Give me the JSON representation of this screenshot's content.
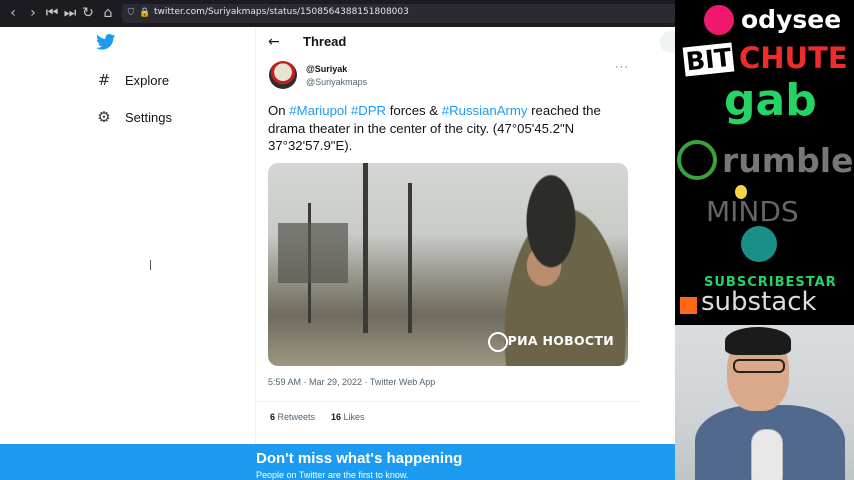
{
  "browser": {
    "url": "twitter.com/Suriyakmaps/status/1508564388151808003",
    "icons": [
      "back-icon",
      "forward-icon",
      "first-icon",
      "last-icon",
      "reload-icon",
      "home-icon",
      "shield-icon",
      "lock-icon"
    ]
  },
  "leftnav": {
    "explore": "Explore",
    "settings": "Settings"
  },
  "thread": {
    "title": "Thread",
    "author_name": "@Suriyak",
    "author_handle": "@Suriyakmaps",
    "text": {
      "p1": "On ",
      "h1": "#Mariupol",
      "p2": " ",
      "h2": "#DPR",
      "p3": " forces & ",
      "h3": "#RussianArmy",
      "p4": " reached the drama theater in the center of the city. (47°05'45.2\"N 37°32'57.9\"E)."
    },
    "media_watermark": "РИА НОВОСТИ",
    "meta": "5:59 AM · Mar 29, 2022 · Twitter Web App",
    "retweets_count": "6",
    "retweets_label": " Retweets",
    "likes_count": "16",
    "likes_label": " Likes"
  },
  "banner": {
    "title": "Don't miss what's happening",
    "subtitle": "People on Twitter are the first to know."
  },
  "overlay": {
    "odysee": "odysee",
    "bit": "BIT",
    "chute": "CHUTE",
    "gab": "gab",
    "rumble": "rumble",
    "minds": "MINDS",
    "subscribestar": "SUBSCRIBESTAR",
    "substack": "substack"
  },
  "colors": {
    "twitter_blue": "#1d9bf0",
    "browser_dark": "#1c1b22",
    "gab_green": "#25d366",
    "bitchute_red": "#ef2c2c",
    "substack_orange": "#ff6719"
  }
}
